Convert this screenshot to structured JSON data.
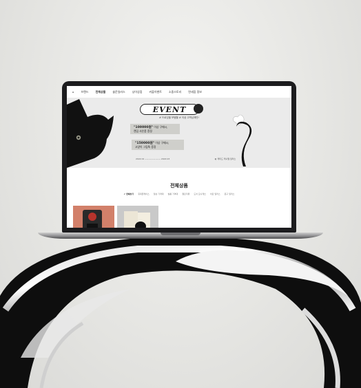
{
  "nav": {
    "home_icon": "home-icon",
    "items": [
      "브랜드",
      "전체상품",
      "솔문일러스",
      "냥이상점",
      "커플이벤트",
      "소중스토리",
      "면세점 정보"
    ]
  },
  "hero": {
    "badge": "EVENT",
    "subtitle": "# 드로잉을 보탬할 # 이상 고객님께만!",
    "notes": [
      {
        "title": "\"100000원\"",
        "rest": "이상 구매시,",
        "line2": "랜덤 사은품 증정"
      },
      {
        "title": "\"150000원\"",
        "rest": "이상 구매시,",
        "line2": "고양이 그립톡 증정"
      }
    ],
    "dates": "2022.01 ~~~~~~~~~ 2022.03",
    "credit": "◐ 캐티드 캐니멀 일러스"
  },
  "products": {
    "title": "전체상품",
    "categories": [
      "✔ 전체보기",
      "휴대폰케이스",
      "일상 가격대",
      "필름 가격대",
      "캘린더류",
      "도어 모니캐츠",
      "어로 일러스",
      "문구 일러스"
    ]
  }
}
